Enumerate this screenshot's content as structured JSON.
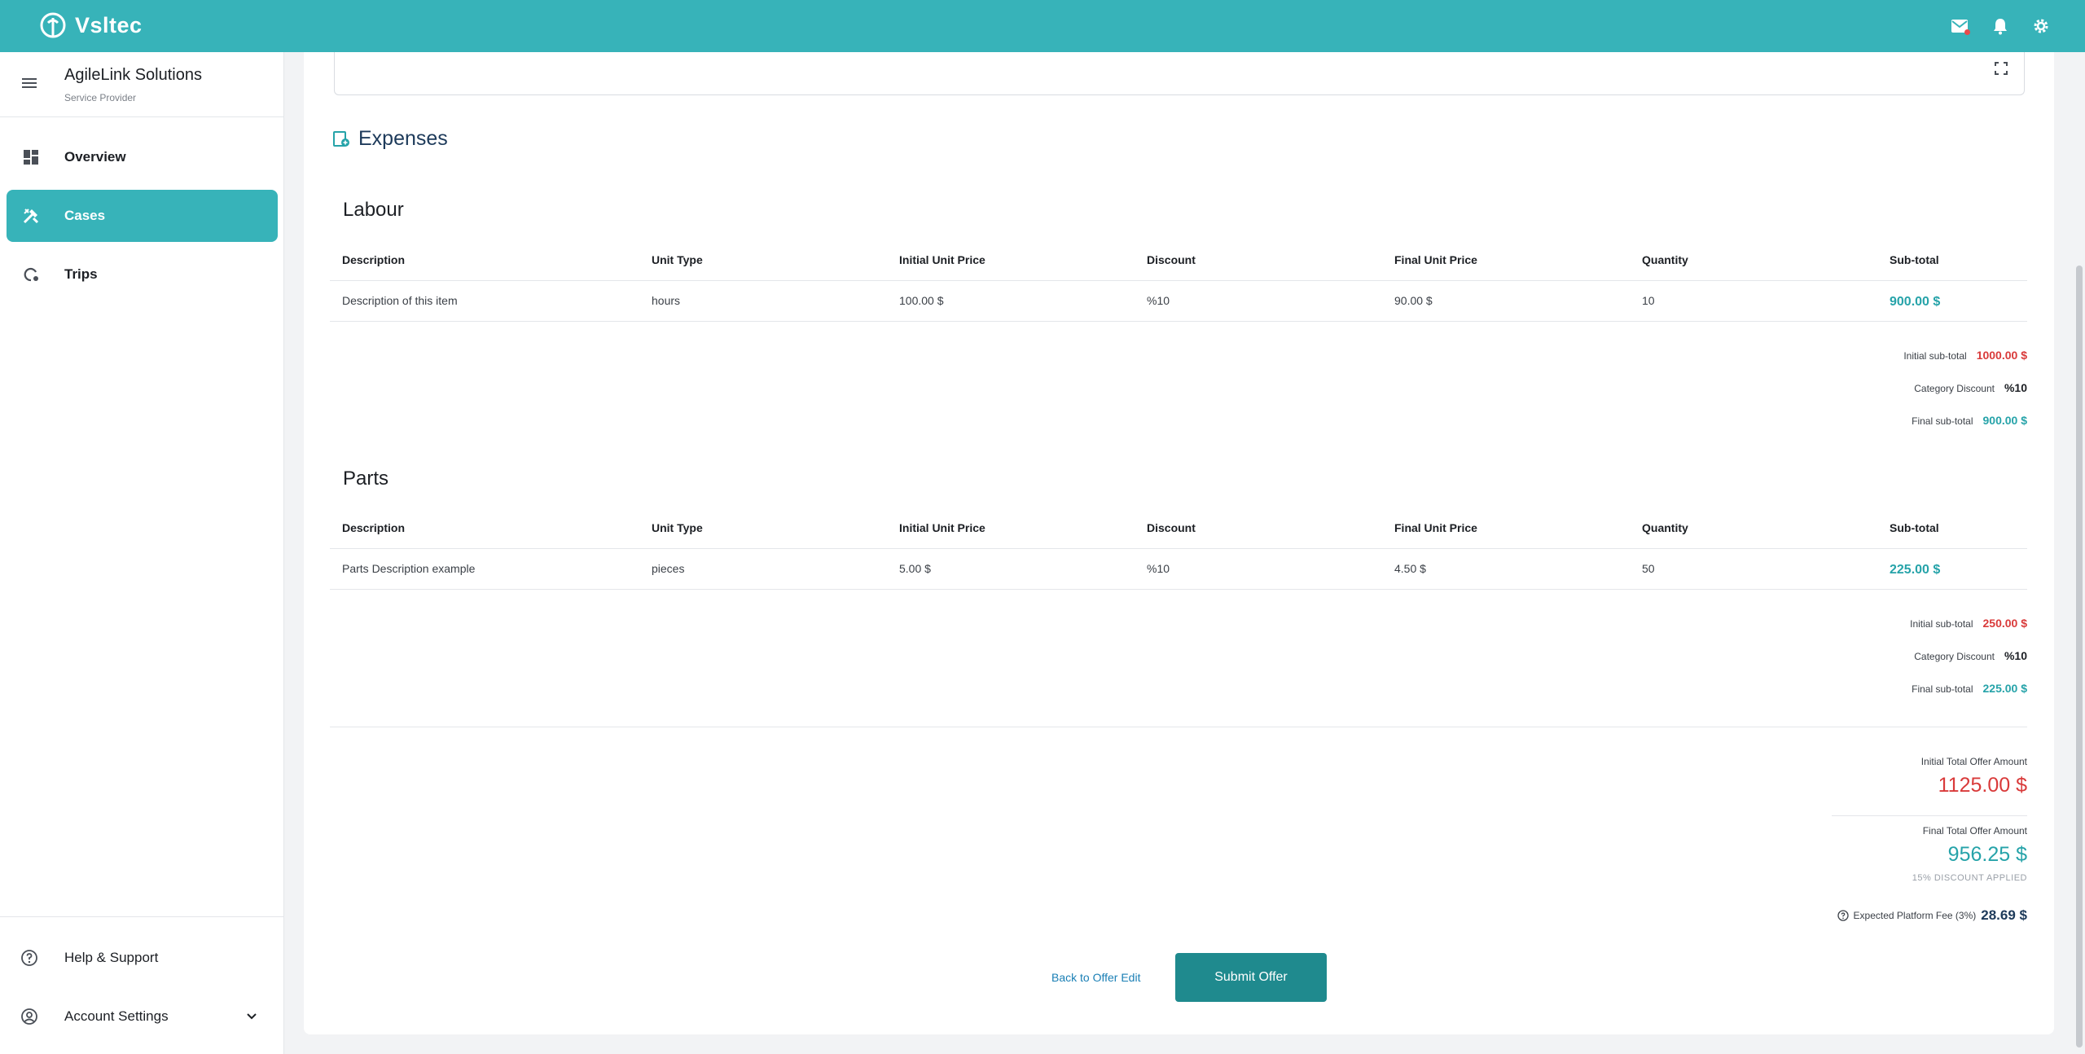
{
  "app": {
    "brand": "Vsltec"
  },
  "org": {
    "name": "AgileLink Solutions",
    "role": "Service Provider"
  },
  "nav": [
    {
      "label": "Overview",
      "icon": "dashboard-icon"
    },
    {
      "label": "Cases",
      "icon": "tools-icon",
      "active": true
    },
    {
      "label": "Trips",
      "icon": "route-icon"
    }
  ],
  "bottom_nav": {
    "help": "Help & Support",
    "account": "Account Settings"
  },
  "expenses": {
    "title": "Expenses",
    "columns": [
      "Description",
      "Unit Type",
      "Initial Unit Price",
      "Discount",
      "Final Unit Price",
      "Quantity",
      "Sub-total"
    ],
    "labour": {
      "title": "Labour",
      "rows": [
        [
          "Description of this item",
          "hours",
          "100.00 $",
          "%10",
          "90.00 $",
          "10",
          "900.00 $"
        ]
      ],
      "initial_label": "Initial sub-total",
      "initial_value": "1000.00 $",
      "discount_label": "Category Discount",
      "discount_value": "%10",
      "final_label": "Final sub-total",
      "final_value": "900.00 $"
    },
    "parts": {
      "title": "Parts",
      "rows": [
        [
          "Parts Description example",
          "pieces",
          "5.00 $",
          "%10",
          "4.50 $",
          "50",
          "225.00 $"
        ]
      ],
      "initial_label": "Initial sub-total",
      "initial_value": "250.00 $",
      "discount_label": "Category Discount",
      "discount_value": "%10",
      "final_label": "Final sub-total",
      "final_value": "225.00 $"
    }
  },
  "totals": {
    "initial_label": "Initial Total Offer Amount",
    "initial_value": "1125.00 $",
    "final_label": "Final Total Offer Amount",
    "final_value": "956.25 $",
    "discount_note": "15% DISCOUNT APPLIED",
    "fee_label": "Expected Platform Fee (3%)",
    "fee_value": "28.69 $"
  },
  "actions": {
    "back": "Back to Offer Edit",
    "submit": "Submit Offer"
  },
  "colors": {
    "brand": "#37b3b9",
    "primary_button": "#1f8a8e",
    "negative": "#d93a3a",
    "positive": "#26a3a9"
  }
}
